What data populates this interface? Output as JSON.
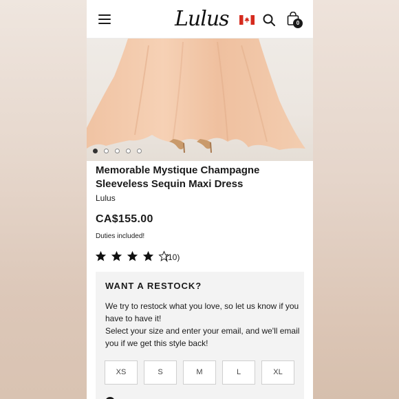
{
  "header": {
    "logo": "Lulus",
    "menu_icon": "hamburger-menu-icon",
    "flag_icon": "canada-flag-icon",
    "search_icon": "search-icon",
    "bag_icon": "shopping-bag-icon",
    "bag_count": "0"
  },
  "gallery": {
    "image_count": 5,
    "active_index": 0
  },
  "product": {
    "title": "Memorable Mystique Champagne Sleeveless Sequin Maxi Dress",
    "brand": "Lulus",
    "price": "CA$155.00",
    "duties": "Duties included!",
    "rating": 4,
    "rating_max": 5,
    "review_count": "(10)"
  },
  "restock": {
    "title": "WANT A RESTOCK?",
    "line1": "We try to restock what you love, so let us know if you have to have it!",
    "line2": "Select your size and enter your email, and we'll email you if we get this style back!",
    "sizes": [
      "XS",
      "S",
      "M",
      "L",
      "XL"
    ]
  },
  "colors": {
    "dress": "#f2c8a8",
    "canada_red": "#d52b1e",
    "restock_bg": "#f3f3f3"
  }
}
